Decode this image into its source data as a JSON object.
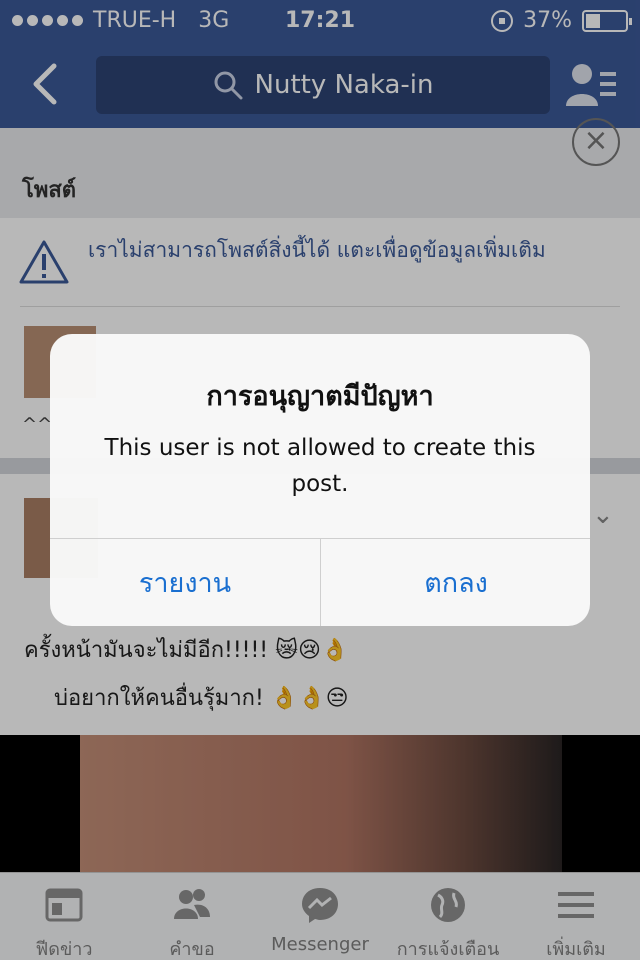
{
  "status_bar": {
    "carrier": "TRUE-H",
    "network": "3G",
    "time": "17:21",
    "battery": "37%",
    "battery_level": 0.37
  },
  "nav": {
    "search_text": "Nutty Naka-in"
  },
  "feed": {
    "section_title": "โพสต์",
    "warning_text": "เราไม่สามารถโพสต์สิ่งนี้ได้ แตะเพื่อดูข้อมูลเพิ่มเติม",
    "post1_snippet": "^^",
    "post2_line1": "ครั้งหน้ามันจะไม่มีอีก!!!!! 😿😢👌",
    "post2_line2": "บ่อยากให้คนอื่นรุ้มาก! 👌👌😒"
  },
  "alert": {
    "title": "การอนุญาตมีปัญหา",
    "message": "This user is not allowed to create this post.",
    "left_button": "รายงาน",
    "right_button": "ตกลง"
  },
  "tabs": [
    {
      "label": "ฟีดข่าว",
      "icon": "news-feed-icon"
    },
    {
      "label": "คำขอ",
      "icon": "friend-requests-icon"
    },
    {
      "label": "Messenger",
      "icon": "messenger-icon"
    },
    {
      "label": "การแจ้งเตือน",
      "icon": "globe-icon"
    },
    {
      "label": "เพิ่มเติม",
      "icon": "menu-icon"
    }
  ],
  "colors": {
    "brand": "#3b5998",
    "alert_button": "#1a6fd0"
  }
}
